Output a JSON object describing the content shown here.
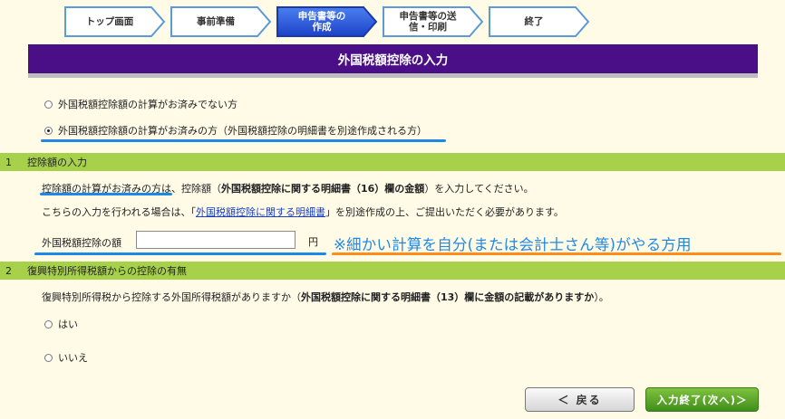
{
  "steps": [
    {
      "label": "トップ画面"
    },
    {
      "label": "事前準備"
    },
    {
      "label": "申告書等の作成"
    },
    {
      "label": "申告書等の送信・印刷"
    },
    {
      "label": "終了"
    }
  ],
  "page_title": "外国税額控除の入力",
  "radio_options": [
    {
      "label": "外国税額控除額の計算がお済みでない方",
      "checked": false
    },
    {
      "label": "外国税額控除額の計算がお済みの方（外国税額控除の明細書を別途作成される方）",
      "checked": true
    }
  ],
  "section1": {
    "number": "1",
    "title": "控除額の入力",
    "desc1_part1": "控除額の計算がお済みの方は、控除額（",
    "desc1_bold": "外国税額控除に関する明細書（16）欄の金額",
    "desc1_part2": "）を入力してください。",
    "desc2_part1": "こちらの入力を行われる場合は、「",
    "desc2_link": "外国税額控除に関する明細書",
    "desc2_part2": "」を別途作成の上、ご提出いただく必要があります。",
    "field_label": "外国税額控除の額",
    "field_value": "",
    "unit": "円"
  },
  "annotation": "※細かい計算を自分(または会計士さん等)がやる方用",
  "section2": {
    "number": "2",
    "title": "復興特別所得税額からの控除の有無",
    "question_part1": "復興特別所得税から控除する外国所得税額がありますか（",
    "question_bold": "外国税額控除に関する明細書（13）欄に金額の記載がありますか",
    "question_part2": "）。",
    "options": [
      {
        "label": "はい"
      },
      {
        "label": "いいえ"
      }
    ]
  },
  "buttons": {
    "back": "＜ 戻る",
    "next": "入力終了(次へ)＞"
  },
  "colors": {
    "title_bar": "#4a0f86",
    "section_bar": "#a7d14a",
    "active_step": "#1f4fd6",
    "annotation": "#1e88e5",
    "highlight_orange": "#ff8c1a"
  }
}
